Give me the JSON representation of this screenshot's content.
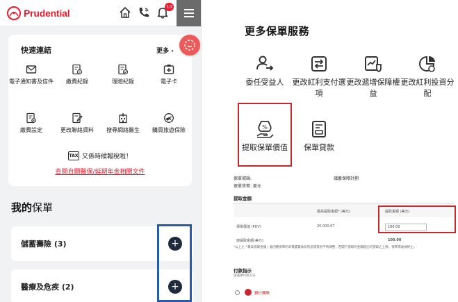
{
  "left": {
    "logo_text": "Prudential",
    "notification_count": "10",
    "quick_links": {
      "title": "快速連結",
      "more": "更多",
      "items": [
        {
          "label": "電子通知書及信件",
          "icon": "mail-icon"
        },
        {
          "label": "繳費紀錄",
          "icon": "payment-record-icon"
        },
        {
          "label": "理賠紀錄",
          "icon": "claims-record-icon"
        },
        {
          "label": "電子卡",
          "icon": "ecard-icon"
        },
        {
          "label": "繳費設定",
          "icon": "payment-settings-icon"
        },
        {
          "label": "更改聯絡資料",
          "icon": "edit-contact-icon"
        },
        {
          "label": "搜尋網絡醫生",
          "icon": "hospital-icon"
        },
        {
          "label": "購買旅遊保險",
          "icon": "travel-insurance-icon"
        }
      ],
      "tax_text": "又係時候報稅啦！",
      "tax_badge": "TAX",
      "ext_link": "查閱自願醫保/延期年金相關文件"
    },
    "my_policies": {
      "title_main": "我的",
      "title_sub": "保單",
      "rows": [
        {
          "label": "儲蓄壽險 (3)"
        },
        {
          "label": "醫療及危疾 (2)"
        }
      ]
    }
  },
  "right": {
    "title": "更多保單服務",
    "services": [
      {
        "label": "委任受益人",
        "icon": "beneficiary-icon"
      },
      {
        "label": "更改紅利支付選項",
        "icon": "dividend-payment-icon"
      },
      {
        "label": "更改遞增保障權益",
        "icon": "increase-protection-icon"
      },
      {
        "label": "更改紅利投資分配",
        "icon": "dividend-allocation-icon"
      },
      {
        "label": "提取保單價值",
        "icon": "withdraw-value-icon"
      },
      {
        "label": "保單貸款",
        "icon": "policy-loan-icon"
      }
    ],
    "doc": {
      "policy_no_label": "保單號碼:",
      "plan_name": "儲蓄保障計劃",
      "currency_label": "保單貨幣: 美元",
      "withdraw_section": "提取金額",
      "col_max": "最高提取金額* (美元)",
      "col_amount": "提取金額 (美元)",
      "row1_label": "保單價值 (PDV)",
      "row1_max": "20,000.67",
      "row1_amount": "100.00",
      "row2_label": "總提取金額(美元)",
      "row2_total": "100.00",
      "note": "*以上之「最高提取金額」會因應保單的未償還貸款及利息或其他不時調整，若閣下提取的金額超出可提取之上限，保單或會被終止。",
      "payment_section": "付款指示",
      "payment_hint": "請選擇付款方法",
      "bank_label": "銀行轉賬"
    }
  }
}
